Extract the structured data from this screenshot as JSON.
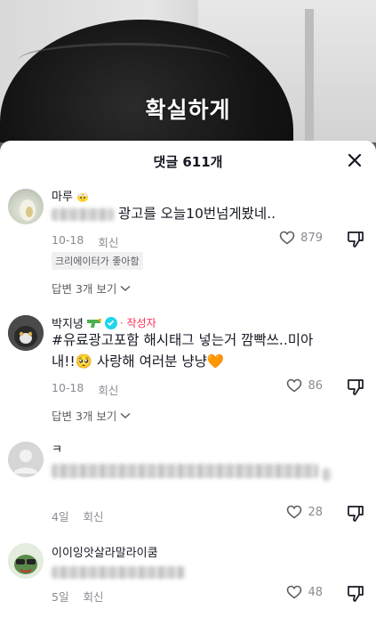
{
  "video": {
    "caption": "확실하게"
  },
  "sheet": {
    "title": "댓글 611개"
  },
  "comments": [
    {
      "username": "마루",
      "text": "광고를 오늘10번넘게봤네..",
      "date": "10-18",
      "reply_label": "회신",
      "likes": "879",
      "badge": "크리에이터가 좋아함",
      "view_replies": "답변 3개 보기"
    },
    {
      "username": "박지녕",
      "author_tag": "· 작성자",
      "text_line1": "#유료광고포함 해시태그 넣는거 깜빡쓰..미아",
      "text_line2": "내!!🥺 사랑해 여러분 냥냥🧡",
      "date": "10-18",
      "reply_label": "회신",
      "likes": "86",
      "view_replies": "답변 3개 보기"
    },
    {
      "username": "ㅋ",
      "date": "4일",
      "reply_label": "회신",
      "likes": "28"
    },
    {
      "username": "이이잉앗살라말라이쿰",
      "date": "5일",
      "reply_label": "회신",
      "likes": "48"
    }
  ]
}
